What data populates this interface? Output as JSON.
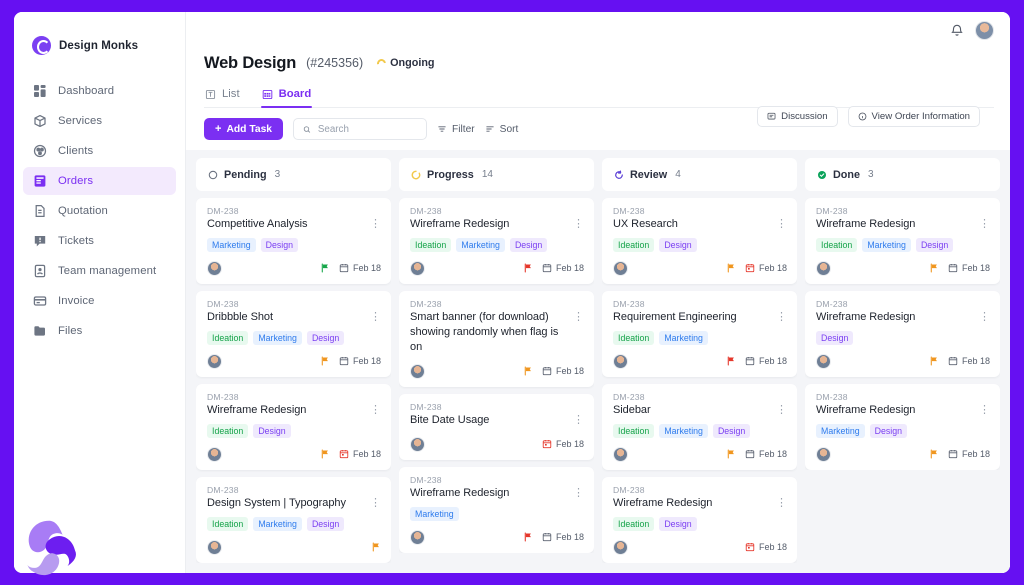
{
  "brand": {
    "name": "Design Monks",
    "logo_icon": "monks-logo-icon"
  },
  "topbar": {
    "bell_icon": "bell-icon",
    "avatar_icon": "user-avatar"
  },
  "sidebar": {
    "items": [
      {
        "label": "Dashboard",
        "icon": "dashboard-icon",
        "active": false
      },
      {
        "label": "Services",
        "icon": "box-icon",
        "active": false
      },
      {
        "label": "Clients",
        "icon": "clients-icon",
        "active": false
      },
      {
        "label": "Orders",
        "icon": "orders-icon",
        "active": true
      },
      {
        "label": "Quotation",
        "icon": "quotation-icon",
        "active": false
      },
      {
        "label": "Tickets",
        "icon": "ticket-icon",
        "active": false
      },
      {
        "label": "Team management",
        "icon": "team-icon",
        "active": false
      },
      {
        "label": "Invoice",
        "icon": "invoice-icon",
        "active": false
      },
      {
        "label": "Files",
        "icon": "folder-icon",
        "active": false
      }
    ]
  },
  "header": {
    "title": "Web Design",
    "order_id": "(#245356)",
    "status": "Ongoing",
    "status_icon": "spinner-icon",
    "buttons": [
      {
        "label": "Discussion",
        "icon": "chat-icon"
      },
      {
        "label": "View Order Information",
        "icon": "info-icon"
      }
    ],
    "tabs": [
      {
        "label": "List",
        "icon": "list-icon",
        "active": false
      },
      {
        "label": "Board",
        "icon": "board-icon",
        "active": true
      }
    ]
  },
  "toolbar": {
    "add_task_label": "Add Task",
    "add_task_icon": "plus-icon",
    "search_placeholder": "Search",
    "search_value": "",
    "search_icon": "search-icon",
    "filter_label": "Filter",
    "filter_icon": "filter-icon",
    "sort_label": "Sort",
    "sort_icon": "sort-icon"
  },
  "colors": {
    "accent": "#7b2ff2",
    "page_border": "#6610f2",
    "board_bg": "#f4f5f8",
    "tag_ideation": "#16a34a",
    "tag_marketing": "#2f7ced",
    "tag_design": "#7b3ff2",
    "flag_green": "#17a74a",
    "flag_orange": "#f0961f",
    "flag_red": "#e5372b",
    "status_ongoing": "#f2c94c",
    "status_done": "#0aa35a"
  },
  "board": {
    "columns": [
      {
        "name": "Pending",
        "count": "3",
        "icon": "circle-icon",
        "icon_color": "#6b7280",
        "cards": [
          {
            "id": "DM-238",
            "title": "Competitive Analysis",
            "tags": [
              "Marketing",
              "Design"
            ],
            "flag": "green",
            "date": "Feb 18",
            "date_overdue": false
          },
          {
            "id": "DM-238",
            "title": "Dribbble Shot",
            "tags": [
              "Ideation",
              "Marketing",
              "Design"
            ],
            "flag": "orange",
            "date": "Feb 18",
            "date_overdue": false
          },
          {
            "id": "DM-238",
            "title": "Wireframe Redesign",
            "tags": [
              "Ideation",
              "Design"
            ],
            "flag": "orange",
            "date": "Feb 18",
            "date_overdue": true
          },
          {
            "id": "DM-238",
            "title": "Design System | Typography",
            "tags": [
              "Ideation",
              "Marketing",
              "Design"
            ],
            "flag": "orange",
            "date": "",
            "date_overdue": false
          }
        ]
      },
      {
        "name": "Progress",
        "count": "14",
        "icon": "spinner-icon",
        "icon_color": "#f2c94c",
        "cards": [
          {
            "id": "DM-238",
            "title": "Wireframe Redesign",
            "tags": [
              "Ideation",
              "Marketing",
              "Design"
            ],
            "flag": "red",
            "date": "Feb 18",
            "date_overdue": false
          },
          {
            "id": "DM-238",
            "title": "Smart banner (for download) showing randomly when flag is on",
            "tags": [],
            "flag": "orange",
            "date": "Feb 18",
            "date_overdue": false
          },
          {
            "id": "DM-238",
            "title": "Bite Date Usage",
            "tags": [],
            "flag": "",
            "date": "Feb 18",
            "date_overdue": true
          },
          {
            "id": "DM-238",
            "title": "Wireframe Redesign",
            "tags": [
              "Marketing"
            ],
            "flag": "red",
            "date": "Feb 18",
            "date_overdue": false
          }
        ]
      },
      {
        "name": "Review",
        "count": "4",
        "icon": "review-icon",
        "icon_color": "#5b3fd6",
        "cards": [
          {
            "id": "DM-238",
            "title": "UX Research",
            "tags": [
              "Ideation",
              "Design"
            ],
            "flag": "orange",
            "date": "Feb 18",
            "date_overdue": true
          },
          {
            "id": "DM-238",
            "title": "Requirement Engineering",
            "tags": [
              "Ideation",
              "Marketing"
            ],
            "flag": "red",
            "date": "Feb 18",
            "date_overdue": false
          },
          {
            "id": "DM-238",
            "title": "Sidebar",
            "tags": [
              "Ideation",
              "Marketing",
              "Design"
            ],
            "flag": "orange",
            "date": "Feb 18",
            "date_overdue": false
          },
          {
            "id": "DM-238",
            "title": "Wireframe Redesign",
            "tags": [
              "Ideation",
              "Design"
            ],
            "flag": "",
            "date": "Feb 18",
            "date_overdue": true
          }
        ]
      },
      {
        "name": "Done",
        "count": "3",
        "icon": "check-circle-icon",
        "icon_color": "#0aa35a",
        "cards": [
          {
            "id": "DM-238",
            "title": "Wireframe Redesign",
            "tags": [
              "Ideation",
              "Marketing",
              "Design"
            ],
            "flag": "orange",
            "date": "Feb 18",
            "date_overdue": false
          },
          {
            "id": "DM-238",
            "title": "Wireframe Redesign",
            "tags": [
              "Design"
            ],
            "flag": "orange",
            "date": "Feb 18",
            "date_overdue": false
          },
          {
            "id": "DM-238",
            "title": "Wireframe Redesign",
            "tags": [
              "Marketing",
              "Design"
            ],
            "flag": "orange",
            "date": "Feb 18",
            "date_overdue": false
          }
        ]
      }
    ]
  }
}
